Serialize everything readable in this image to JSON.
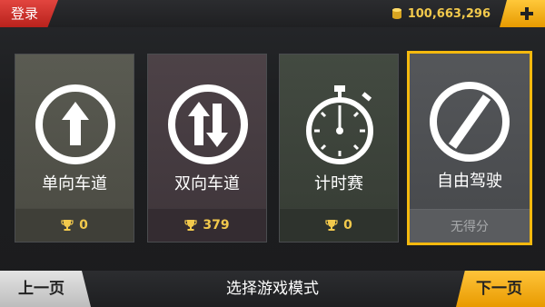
{
  "topbar": {
    "login_label": "登录",
    "coins": "100,663,296"
  },
  "modes": [
    {
      "label": "单向车道",
      "score": "0",
      "icon": "one-way-arrow-icon"
    },
    {
      "label": "双向车道",
      "score": "379",
      "icon": "two-way-arrows-icon"
    },
    {
      "label": "计时赛",
      "score": "0",
      "icon": "stopwatch-icon"
    },
    {
      "label": "自由驾驶",
      "score": "无得分",
      "icon": "no-limit-icon",
      "selected": true
    }
  ],
  "bottombar": {
    "prev_label": "上一页",
    "title": "选择游戏模式",
    "next_label": "下一页"
  },
  "colors": {
    "accent": "#f5b90e",
    "login": "#d13a34",
    "gold_text": "#f2c94c"
  }
}
